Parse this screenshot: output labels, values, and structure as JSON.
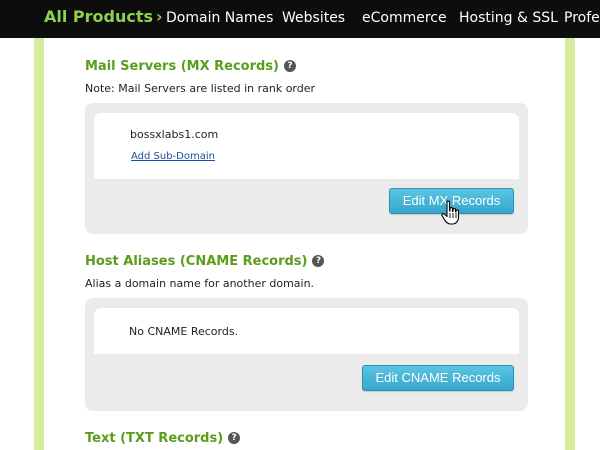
{
  "nav": {
    "all_products": "All Products",
    "chevron": "›",
    "items": [
      "Domain Names",
      "Websites",
      "eCommerce",
      "Hosting & SSL",
      "Profes"
    ]
  },
  "mx": {
    "title": "Mail Servers (MX Records)",
    "help": "?",
    "note": "Note: Mail Servers are listed in rank order",
    "domain": "bossxlabs1.com",
    "add_link": "Add Sub-Domain",
    "button": "Edit MX Records"
  },
  "cname": {
    "title": "Host Aliases (CNAME Records)",
    "help": "?",
    "note": "Alias a domain name for another domain.",
    "empty": "No CNAME Records.",
    "button": "Edit CNAME Records"
  },
  "txt": {
    "title": "Text (TXT Records)",
    "help": "?"
  },
  "colors": {
    "nav_bg": "#0d0d0d",
    "accent_green": "#8fd14f",
    "heading_green": "#5a9d1a",
    "rail_green": "#d4ec9c",
    "button_blue": "#36a7cc",
    "panel_gray": "#ebebeb"
  },
  "icons": {
    "help": "help-circle-icon",
    "pointer": "hand-pointer-icon"
  }
}
